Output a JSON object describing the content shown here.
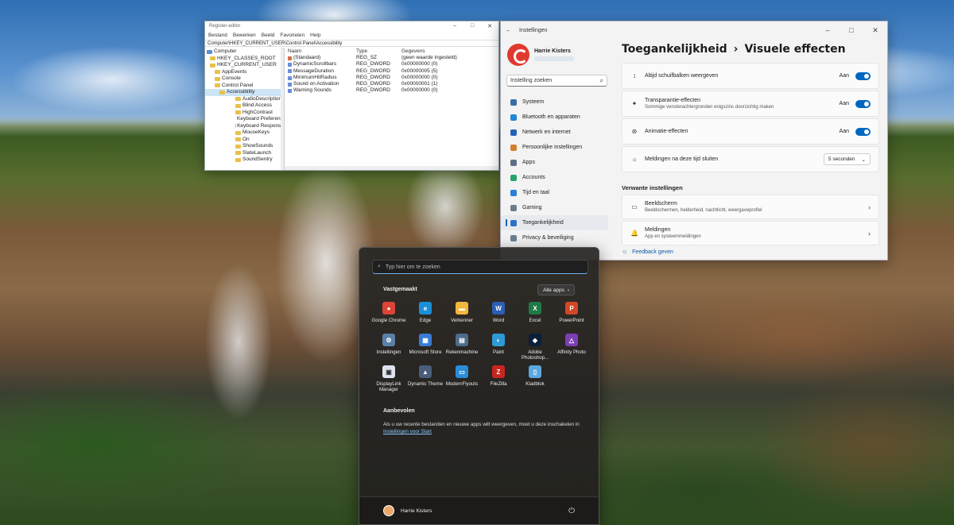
{
  "regedit": {
    "title": "Register-editor",
    "menu": [
      "Bestand",
      "Bewerken",
      "Beeld",
      "Favorieten",
      "Help"
    ],
    "path": "Computer\\HKEY_CURRENT_USER\\Control Panel\\Accessibility",
    "tree": [
      {
        "label": "Computer",
        "level": 0,
        "type": "computer"
      },
      {
        "label": "HKEY_CLASSES_ROOT",
        "level": 1,
        "type": "folder"
      },
      {
        "label": "HKEY_CURRENT_USER",
        "level": 1,
        "type": "folder"
      },
      {
        "label": "AppEvents",
        "level": 2,
        "type": "folder"
      },
      {
        "label": "Console",
        "level": 2,
        "type": "folder"
      },
      {
        "label": "Control Panel",
        "level": 2,
        "type": "folder"
      },
      {
        "label": "Accessibility",
        "level": 3,
        "type": "folder",
        "selected": true
      },
      {
        "label": "AudioDescription",
        "level": 4,
        "type": "folder"
      },
      {
        "label": "Blind Access",
        "level": 4,
        "type": "folder"
      },
      {
        "label": "HighContrast",
        "level": 4,
        "type": "folder"
      },
      {
        "label": "Keyboard Preference",
        "level": 4,
        "type": "folder"
      },
      {
        "label": "Keyboard Response",
        "level": 4,
        "type": "folder"
      },
      {
        "label": "MouseKeys",
        "level": 4,
        "type": "folder"
      },
      {
        "label": "On",
        "level": 4,
        "type": "folder"
      },
      {
        "label": "ShowSounds",
        "level": 4,
        "type": "folder"
      },
      {
        "label": "SlateLaunch",
        "level": 4,
        "type": "folder"
      },
      {
        "label": "SoundSentry",
        "level": 4,
        "type": "folder"
      }
    ],
    "columns": [
      "Naam",
      "Type",
      "Gegevens"
    ],
    "rows": [
      {
        "name": "(Standaard)",
        "type": "REG_SZ",
        "data": "(geen waarde ingesteld)",
        "kind": "sz"
      },
      {
        "name": "DynamicScrollbars",
        "type": "REG_DWORD",
        "data": "0x00000000 (0)",
        "kind": "dword"
      },
      {
        "name": "MessageDuration",
        "type": "REG_DWORD",
        "data": "0x00000005 (5)",
        "kind": "dword"
      },
      {
        "name": "MinimumHitRadius",
        "type": "REG_DWORD",
        "data": "0x00000000 (0)",
        "kind": "dword"
      },
      {
        "name": "Sound on Activation",
        "type": "REG_DWORD",
        "data": "0x00000001 (1)",
        "kind": "dword"
      },
      {
        "name": "Warning Sounds",
        "type": "REG_DWORD",
        "data": "0x00000000 (0)",
        "kind": "dword"
      }
    ]
  },
  "settings": {
    "title": "Instellingen",
    "user_name": "Harrie Kisters",
    "search_placeholder": "Instelling zoeken",
    "nav": [
      {
        "label": "Systeem",
        "color": "#3a6ea5"
      },
      {
        "label": "Bluetooth en apparaten",
        "color": "#1f86d8"
      },
      {
        "label": "Netwerk en internet",
        "color": "#2563b8"
      },
      {
        "label": "Persoonlijke instellingen",
        "color": "#d1802b"
      },
      {
        "label": "Apps",
        "color": "#5d6f87"
      },
      {
        "label": "Accounts",
        "color": "#27a36c"
      },
      {
        "label": "Tijd en taal",
        "color": "#2a7fd6"
      },
      {
        "label": "Gaming",
        "color": "#6d7c8c"
      },
      {
        "label": "Toegankelijkheid",
        "color": "#2c72c4",
        "active": true
      },
      {
        "label": "Privacy & beveiliging",
        "color": "#6b7f92"
      }
    ],
    "breadcrumb_parent": "Toegankelijkheid",
    "breadcrumb_sep": "›",
    "breadcrumb_current": "Visuele effecten",
    "options": [
      {
        "label": "Altijd schuifbalken weergeven",
        "sub": "",
        "state": "Aan",
        "icon": "↕"
      },
      {
        "label": "Transparantie-effecten",
        "sub": "Sommige vensterachtergronden enigszins doorzichtig maken",
        "state": "Aan",
        "icon": "✦"
      },
      {
        "label": "Animatie-effecten",
        "sub": "",
        "state": "Aan",
        "icon": "⊛"
      }
    ],
    "notif_label": "Meldingen na deze tijd sluiten",
    "notif_value": "5 seconden",
    "related_heading": "Verwante instellingen",
    "related": [
      {
        "label": "Beeldscherm",
        "sub": "Beeldschermen, helderheid, nachtlicht, weergaveprofiel",
        "icon": "▭"
      },
      {
        "label": "Meldingen",
        "sub": "App en systeemmeldingen",
        "icon": "🔔"
      }
    ],
    "feedback": "Feedback geven"
  },
  "start": {
    "search_placeholder": "Typ hier om te zoeken",
    "pinned_heading": "Vastgemaakt",
    "all_apps": "Alle apps",
    "apps": [
      {
        "label": "Google Chrome",
        "color": "#db4437",
        "glyph": "●"
      },
      {
        "label": "Edge",
        "color": "#1b8fd6",
        "glyph": "e"
      },
      {
        "label": "Verkenner",
        "color": "#f2b73c",
        "glyph": "▬"
      },
      {
        "label": "Word",
        "color": "#2b5fb4",
        "glyph": "W"
      },
      {
        "label": "Excel",
        "color": "#1f7a44",
        "glyph": "X"
      },
      {
        "label": "PowerPoint",
        "color": "#d24726",
        "glyph": "P"
      },
      {
        "label": "Instellingen",
        "color": "#5b7fa6",
        "glyph": "⚙"
      },
      {
        "label": "Microsoft Store",
        "color": "#3a7bd5",
        "glyph": "▦"
      },
      {
        "label": "Rekenmachine",
        "color": "#4e6c8a",
        "glyph": "▤"
      },
      {
        "label": "Paint",
        "color": "#2e9bd6",
        "glyph": "◐"
      },
      {
        "label": "Adobe Photoshop...",
        "color": "#0b1f3a",
        "glyph": "◆"
      },
      {
        "label": "Affinity Photo",
        "color": "#7b3fb5",
        "glyph": "△"
      },
      {
        "label": "DisplayLink Manager",
        "color": "#dde4ee",
        "glyph": "▣"
      },
      {
        "label": "Dynamic Theme",
        "color": "#4a5d7a",
        "glyph": "▲"
      },
      {
        "label": "ModernFlyouts",
        "color": "#2a8bd8",
        "glyph": "▭"
      },
      {
        "label": "FileZilla",
        "color": "#c8261f",
        "glyph": "Z"
      },
      {
        "label": "Kladblok",
        "color": "#5aa7e0",
        "glyph": "▯"
      }
    ],
    "recommended_heading": "Aanbevolen",
    "recommended_text": "Als u uw recente bestanden en nieuwe apps wilt weergeven, moet u deze inschakelen in",
    "recommended_link": "Instellingen voor Start",
    "user_name": "Harrie Kisters"
  }
}
